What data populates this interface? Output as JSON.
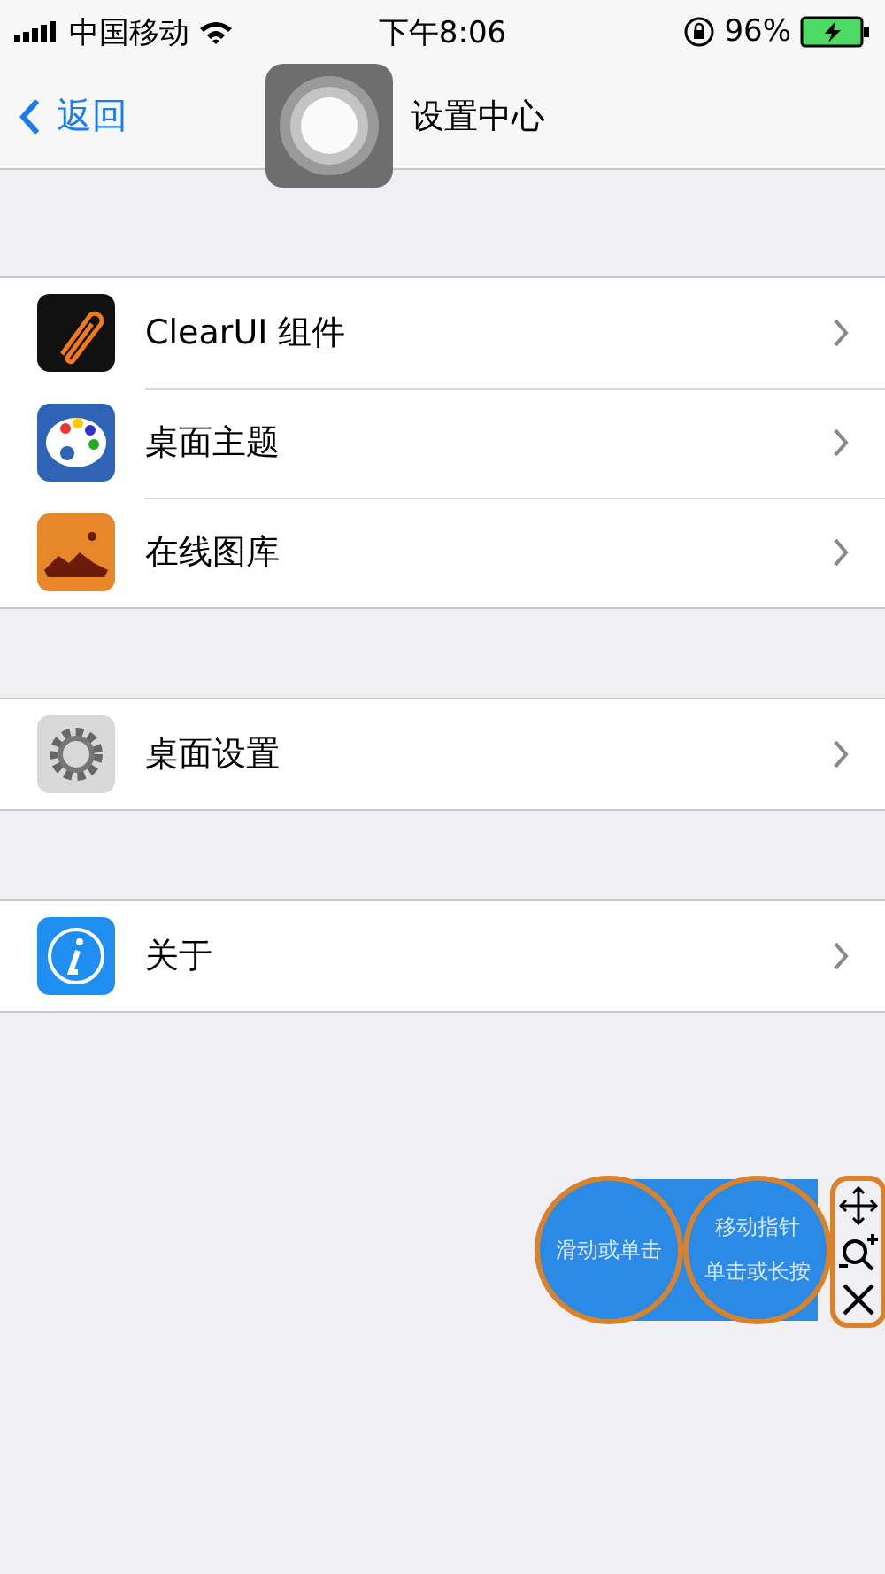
{
  "status_bar": {
    "carrier": "中国移动",
    "time": "下午8:06",
    "battery": "96%"
  },
  "nav": {
    "back": "返回",
    "title": "设置中心"
  },
  "sections": [
    {
      "rows": [
        {
          "kind": "clip",
          "label": "ClearUI 组件"
        },
        {
          "kind": "palette",
          "label": "桌面主题"
        },
        {
          "kind": "gallery",
          "label": "在线图库"
        }
      ]
    },
    {
      "rows": [
        {
          "kind": "gear",
          "label": "桌面设置"
        }
      ]
    },
    {
      "rows": [
        {
          "kind": "info",
          "label": "关于"
        }
      ]
    }
  ],
  "float_panel": {
    "swipe": "滑动或单击",
    "pointer_line1": "移动指针",
    "pointer_line2": "单击或长按"
  }
}
